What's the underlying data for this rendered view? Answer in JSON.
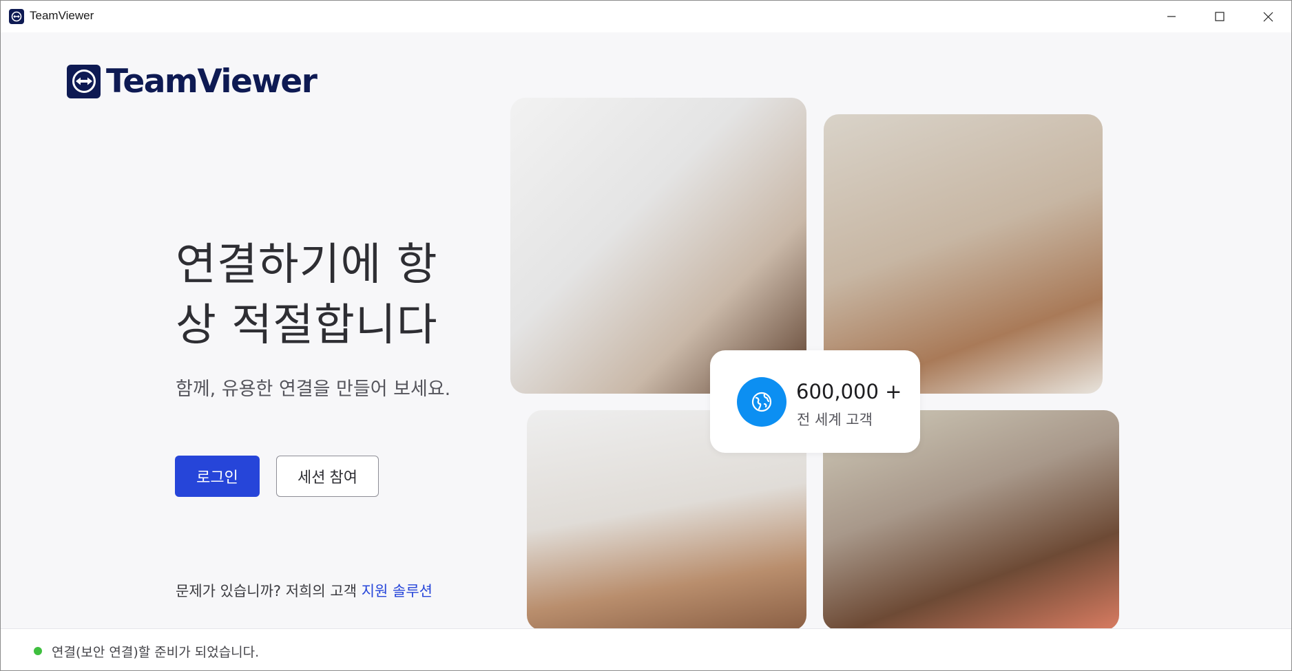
{
  "window": {
    "title": "TeamViewer"
  },
  "logo": {
    "wordmark": "TeamViewer"
  },
  "hero": {
    "headline_line1": "연결하기에 항",
    "headline_line2": "상 적절합니다",
    "subline": "함께, 유용한 연결을 만들어 보세요."
  },
  "actions": {
    "login_label": "로그인",
    "join_session_label": "세션 참여"
  },
  "help": {
    "prefix": "문제가 있습니까? 저희의 고객 ",
    "link": "지원 솔루션"
  },
  "stat": {
    "number": "600,000 +",
    "label": "전 세계 고객",
    "icon": "globe-icon"
  },
  "status": {
    "message": "연결(보안 연결)할 준비가 되었습니다.",
    "indicator_color": "#3fbf3f"
  },
  "colors": {
    "brand_navy": "#0e1a53",
    "primary_blue": "#2645d9",
    "accent_blue": "#0c8ff2"
  }
}
